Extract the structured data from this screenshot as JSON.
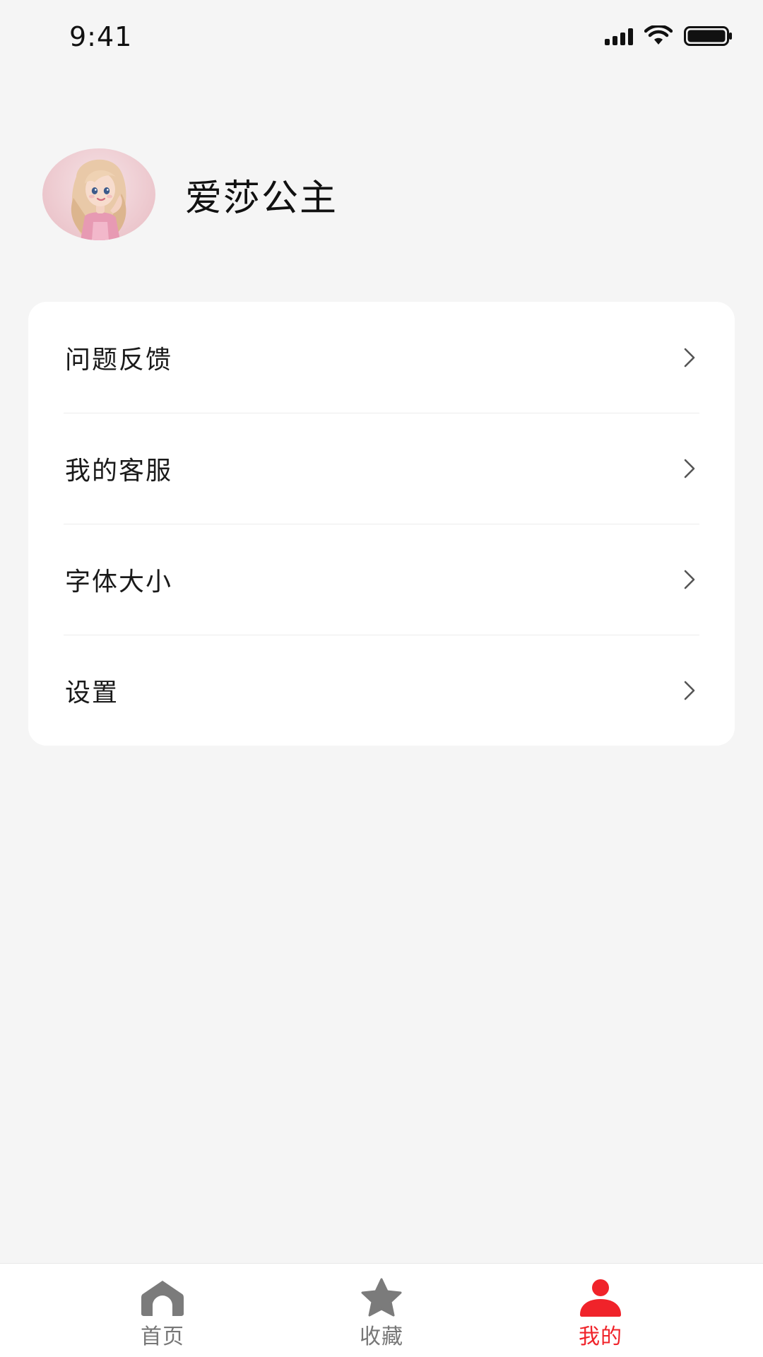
{
  "status_bar": {
    "time": "9:41"
  },
  "profile": {
    "username": "爱莎公主",
    "avatar_icon": "princess-avatar"
  },
  "menu": {
    "items": [
      {
        "label": "问题反馈",
        "icon": "chevron-right-icon"
      },
      {
        "label": "我的客服",
        "icon": "chevron-right-icon"
      },
      {
        "label": "字体大小",
        "icon": "chevron-right-icon"
      },
      {
        "label": "设置",
        "icon": "chevron-right-icon"
      }
    ]
  },
  "tabs": [
    {
      "label": "首页",
      "icon": "home-icon",
      "active": false
    },
    {
      "label": "收藏",
      "icon": "star-icon",
      "active": false
    },
    {
      "label": "我的",
      "icon": "user-icon",
      "active": true
    }
  ],
  "colors": {
    "background": "#f5f5f5",
    "card": "#ffffff",
    "accent": "#f0232a",
    "inactive_tab": "#777777"
  }
}
